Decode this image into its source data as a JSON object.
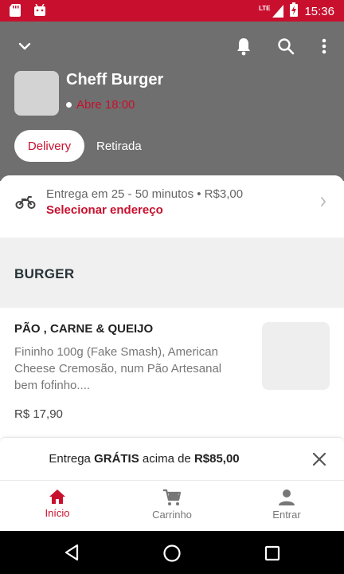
{
  "status_bar": {
    "network": "LTE",
    "time": "15:36"
  },
  "store": {
    "name": "Cheff Burger",
    "status": "Abre 18:00"
  },
  "modes": {
    "delivery": "Delivery",
    "pickup": "Retirada"
  },
  "delivery": {
    "info": "Entrega em 25 - 50 minutos • R$3,00",
    "select_address": "Selecionar endereço"
  },
  "section": {
    "title": "BURGER"
  },
  "product": {
    "name": "PÃO , CARNE & QUEIJO",
    "description": "Fininho 100g (Fake Smash), American Cheese Cremosão, num Pão Artesanal bem fofinho....",
    "price": "R$ 17,90"
  },
  "banner": {
    "prefix": "Entrega ",
    "highlight": "GRÁTIS",
    "middle": " acima de ",
    "amount": "R$85,00"
  },
  "bottom_nav": {
    "home": "Início",
    "cart": "Carrinho",
    "login": "Entrar"
  },
  "colors": {
    "accent": "#c8102e",
    "header_bg": "#6f6f6f"
  },
  "icons": [
    "chevron-down-icon",
    "bell-icon",
    "search-icon",
    "more-vert-icon",
    "motorcycle-icon",
    "chevron-right-icon",
    "close-icon",
    "home-icon",
    "cart-icon",
    "person-icon",
    "back-icon",
    "home-circle-icon",
    "recents-icon"
  ]
}
